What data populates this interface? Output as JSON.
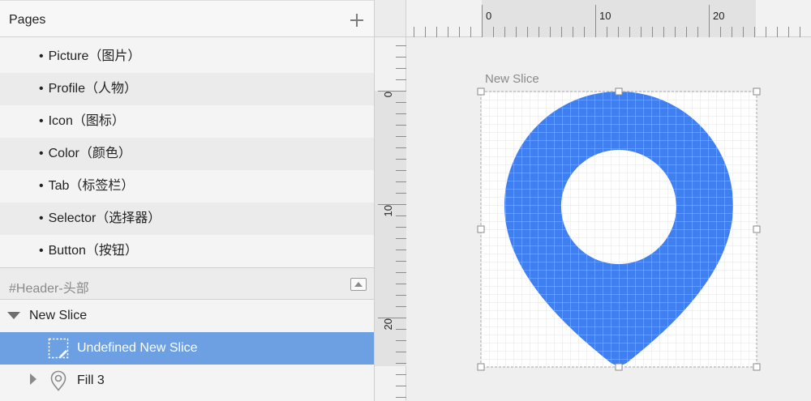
{
  "pages_panel": {
    "title": "Pages",
    "add_icon": "plus-icon",
    "items": [
      {
        "label": "Picture（图片）"
      },
      {
        "label": "Profile（人物）"
      },
      {
        "label": "Icon（图标）"
      },
      {
        "label": "Color（颜色）"
      },
      {
        "label": "Tab（标签栏）"
      },
      {
        "label": "Selector（选择器）"
      },
      {
        "label": "Button（按钮）"
      }
    ]
  },
  "layers": {
    "group_label": "#Header-头部",
    "collapse_icon": "collapse-icon",
    "rows": [
      {
        "label": "New Slice",
        "icon": "disclosure-down-icon"
      },
      {
        "label": "Undefined New Slice",
        "icon": "slice-icon",
        "selected": true
      },
      {
        "label": "Fill 3",
        "icon": "pin-icon"
      }
    ]
  },
  "rulers": {
    "horizontal_labels": [
      "0",
      "10",
      "20"
    ],
    "vertical_labels": [
      "0",
      "10",
      "20"
    ]
  },
  "canvas": {
    "slice_name": "New Slice",
    "pin_color": "#3f7ff0",
    "selection_color": "#6ca0e3"
  }
}
